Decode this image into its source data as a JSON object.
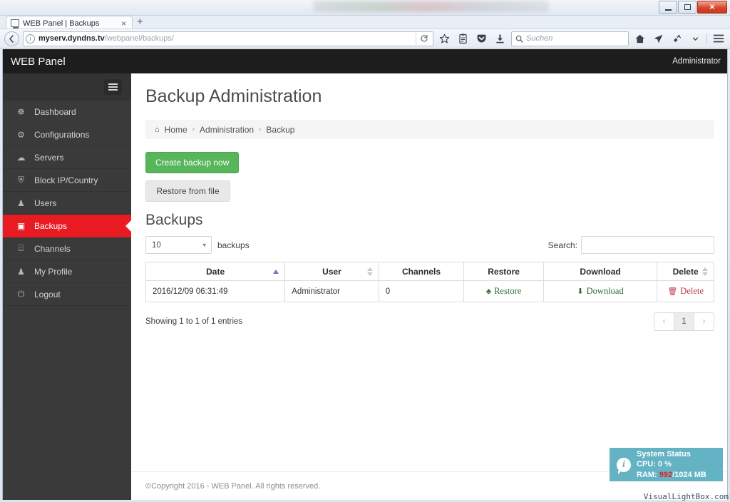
{
  "browser": {
    "tab": {
      "title": "WEB Panel | Backups",
      "close_label": "×",
      "icon": "window-icon"
    },
    "new_tab_label": "+",
    "url": {
      "host": "myserv.dyndns.tv",
      "path": "/webpanel/backups/"
    },
    "reload_label": "↻",
    "back_label": "←",
    "search": {
      "placeholder": "Suchen",
      "icon": "search-icon"
    },
    "toolbar_icons": [
      "star-icon",
      "library-icon",
      "pocket-icon",
      "download-icon",
      "home-icon",
      "send-tab-icon",
      "plugin-icon",
      "chevron-down-icon",
      "hamburger-menu-icon"
    ],
    "window_controls": {
      "minimize": "minimize-icon",
      "maximize": "maximize-icon",
      "close": "✕"
    }
  },
  "app": {
    "brand": "WEB Panel",
    "user": "Administrator",
    "sidebar": {
      "toggle": "sidebar-toggle",
      "items": [
        {
          "label": "Dashboard",
          "icon": "☸",
          "active": false
        },
        {
          "label": "Configurations",
          "icon": "⚙",
          "active": false
        },
        {
          "label": "Servers",
          "icon": "☁",
          "active": false
        },
        {
          "label": "Block IP/Country",
          "icon": "⛨",
          "active": false
        },
        {
          "label": "Users",
          "icon": "♟",
          "active": false
        },
        {
          "label": "Backups",
          "icon": "▣",
          "active": true
        },
        {
          "label": "Channels",
          "icon": "⌸",
          "active": false
        },
        {
          "label": "My Profile",
          "icon": "♟",
          "active": false
        },
        {
          "label": "Logout",
          "icon": "⏻",
          "active": false
        }
      ]
    },
    "page": {
      "title": "Backup Administration",
      "breadcrumb": {
        "home_icon": "⌂",
        "items": [
          "Home",
          "Administration",
          "Backup"
        ],
        "separator": "›"
      },
      "buttons": {
        "create_backup": "Create backup now",
        "restore_from_file": "Restore from file"
      },
      "section_title": "Backups",
      "table_controls": {
        "length_value": "10",
        "length_suffix": "backups",
        "search_label": "Search:",
        "search_value": ""
      },
      "table": {
        "columns": [
          {
            "label": "Date",
            "sort": "asc"
          },
          {
            "label": "User",
            "sort": "both"
          },
          {
            "label": "Channels",
            "sort": "none"
          },
          {
            "label": "Restore",
            "sort": "none"
          },
          {
            "label": "Download",
            "sort": "none"
          },
          {
            "label": "Delete",
            "sort": "both"
          }
        ],
        "rows": [
          {
            "date": "2016/12/09 06:31:49",
            "user": "Administrator",
            "channels": "0",
            "restore": "Restore",
            "download": "Download",
            "delete": "Delete"
          }
        ]
      },
      "footer": {
        "entries_info": "Showing 1 to 1 of 1 entries",
        "pager": {
          "prev": "‹",
          "current": "1",
          "next": "›"
        }
      },
      "copyright": "©Copyright 2016 - WEB Panel. All rights reserved."
    },
    "system_status": {
      "title": "System Status",
      "cpu_label": "CPU: 0 %",
      "ram_prefix": "RAM: ",
      "ram_used": "992",
      "ram_total": "/1024 MB"
    }
  },
  "watermark": "VisualLightBox.com",
  "colors": {
    "accent_red": "#e81a22",
    "btn_green": "#57b55a",
    "sidebar_bg": "#3a3a3a",
    "topbar_bg": "#1d1d1d",
    "sysbox_bg": "#63b3c4",
    "ram_alert": "#e02020",
    "sort_active": "#6b78c9"
  }
}
